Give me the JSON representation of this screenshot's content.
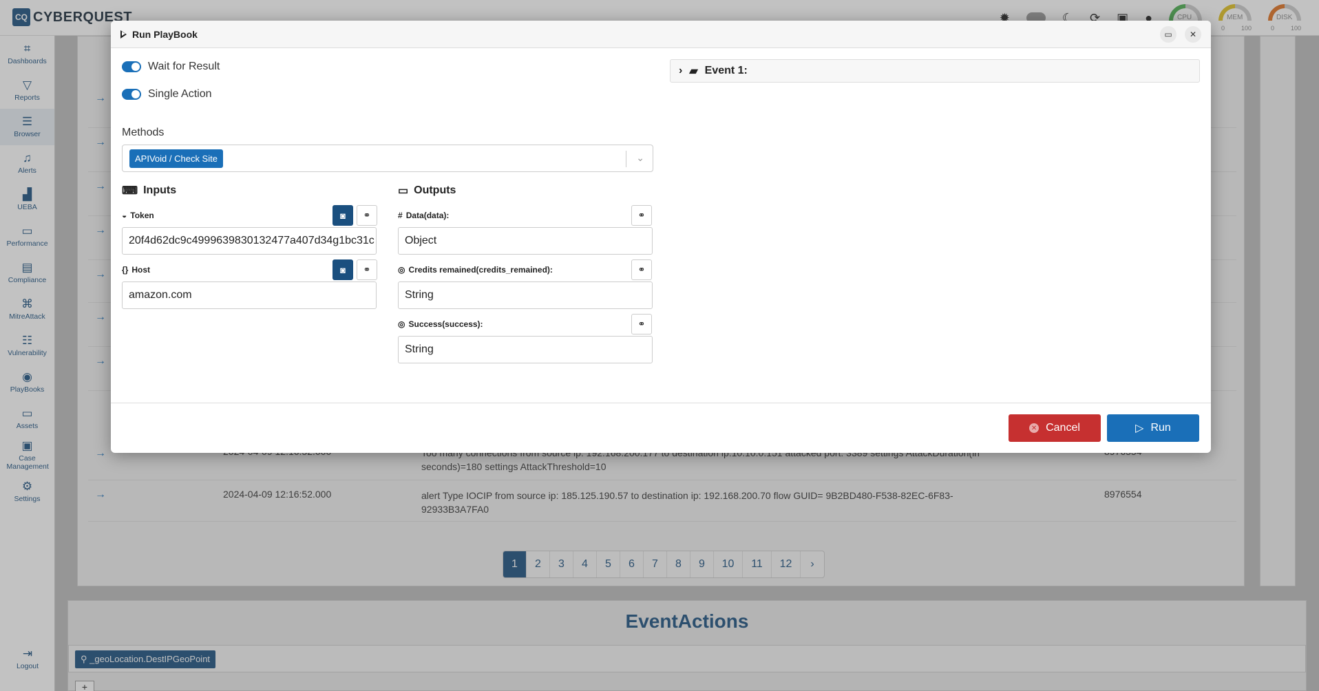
{
  "app": {
    "logo_mark": "CQ",
    "logo_text": "CYBERQUEST"
  },
  "topbar": {
    "gauges": [
      {
        "label": "CPU",
        "min": "0",
        "max": "100"
      },
      {
        "label": "MEM",
        "min": "0",
        "max": "100"
      },
      {
        "label": "DISK",
        "min": "0",
        "max": "100"
      }
    ]
  },
  "sidebar": {
    "items": [
      {
        "label": "Dashboards",
        "icon": "dashboard-icon"
      },
      {
        "label": "Reports",
        "icon": "filter-icon"
      },
      {
        "label": "Browser",
        "icon": "list-icon"
      },
      {
        "label": "Alerts",
        "icon": "bell-icon"
      },
      {
        "label": "UEBA",
        "icon": "chart-icon"
      },
      {
        "label": "Performance",
        "icon": "keyboard-icon"
      },
      {
        "label": "Compliance",
        "icon": "document-icon"
      },
      {
        "label": "MitreAttack",
        "icon": "command-icon"
      },
      {
        "label": "Vulnerability",
        "icon": "server-icon"
      },
      {
        "label": "PlayBooks",
        "icon": "playbooks-icon"
      },
      {
        "label": "Assets",
        "icon": "laptop-icon"
      },
      {
        "label": "Case Management",
        "icon": "briefcase-icon"
      },
      {
        "label": "Settings",
        "icon": "gear-icon"
      }
    ],
    "logout": "Logout"
  },
  "background": {
    "rows": [
      {
        "time": "2024-04-09 12:16:52.000",
        "message": "Too many connections from source ip: 192.168.200.177 to destination ip:10.10.0.151 attacked port: 3389 settings AttackDuration(in seconds)=180 settings AttackThreshold=10",
        "id": "8976554"
      },
      {
        "time": "2024-04-09 12:16:52.000",
        "message": "alert Type IOCIP from source ip: 185.125.190.57 to destination ip: 192.168.200.70 flow GUID= 9B2BD480-F538-82EC-6F83-92933B3A7FA0",
        "id": "8976554"
      }
    ],
    "pages": [
      "1",
      "2",
      "3",
      "4",
      "5",
      "6",
      "7",
      "8",
      "9",
      "10",
      "11",
      "12",
      "›"
    ],
    "event_actions_title": "EventActions",
    "event_actions_tag": "_geoLocation.DestIPGeoPoint"
  },
  "modal": {
    "title": "Run PlayBook",
    "wait_for_result": "Wait for Result",
    "single_action": "Single Action",
    "methods_label": "Methods",
    "methods_selected": "APIVoid / Check Site",
    "inputs_title": "Inputs",
    "outputs_title": "Outputs",
    "inputs": [
      {
        "label": "Token",
        "value": "20f4d62dc9c4999639830132477a407d34g1bc31c"
      },
      {
        "label": "Host",
        "value": "amazon.com"
      }
    ],
    "outputs": [
      {
        "label": "Data(data):",
        "value": "Object"
      },
      {
        "label": "Credits remained(credits_remained):",
        "value": "String"
      },
      {
        "label": "Success(success):",
        "value": "String"
      }
    ],
    "event_label": "Event 1:",
    "cancel_label": "Cancel",
    "run_label": "Run"
  },
  "colors": {
    "primary": "#1a6fb8",
    "dark": "#1a4f7f",
    "danger": "#c63030"
  }
}
